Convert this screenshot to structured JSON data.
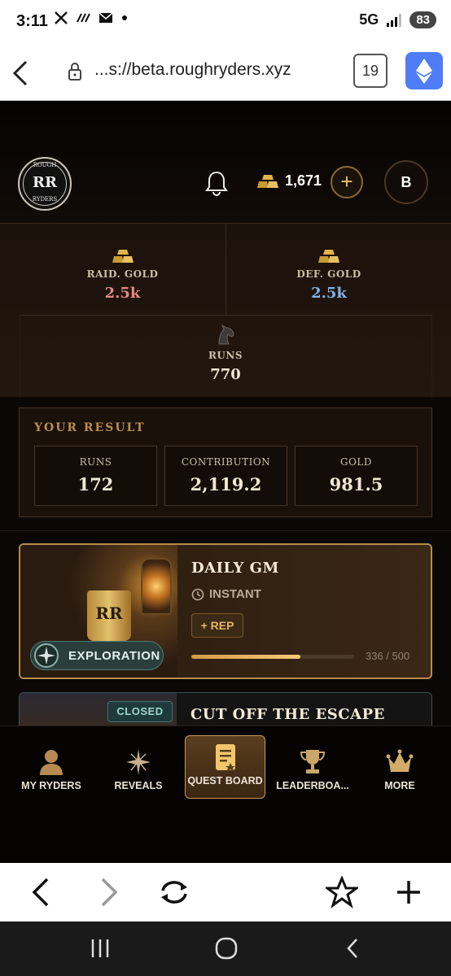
{
  "status_bar": {
    "time": "3:11",
    "network": "5G",
    "battery": "83"
  },
  "browser": {
    "url": "...s://beta.roughryders.xyz",
    "tab_count": "19"
  },
  "header": {
    "logo": {
      "top_text": "ROUGH",
      "monogram": "RR",
      "bottom_text": "RYDERS"
    },
    "gold_balance": "1,671",
    "avatar_initial": "B"
  },
  "stats": {
    "raid_gold": {
      "label": "RAID. GOLD",
      "value": "2.5k",
      "color": "#e58a86"
    },
    "def_gold": {
      "label": "DEF. GOLD",
      "value": "2.5k",
      "color": "#7fb3e8"
    },
    "runs": {
      "label": "RUNS",
      "value": "770",
      "color": "#f1e6d3"
    }
  },
  "your_result": {
    "title": "YOUR RESULT",
    "items": [
      {
        "label": "RUNS",
        "value": "172"
      },
      {
        "label": "CONTRIBUTION",
        "value": "2,119.2"
      },
      {
        "label": "GOLD",
        "value": "981.5"
      }
    ]
  },
  "quests": [
    {
      "title": "DAILY GM",
      "type_label": "INSTANT",
      "reward_label": "+ REP",
      "category": "EXPLORATION",
      "progress": {
        "current": 336,
        "total": 500,
        "text": "336 / 500"
      },
      "image_monogram": "RR"
    },
    {
      "title": "CUT OFF THE ESCAPE",
      "status": "CLOSED"
    }
  ],
  "bottom_nav": [
    {
      "label": "MY RYDERS",
      "icon": "person-icon"
    },
    {
      "label": "REVEALS",
      "icon": "sparkle-icon"
    },
    {
      "label": "QUEST BOARD",
      "icon": "quest-scroll-icon",
      "active": true
    },
    {
      "label": "LEADERBOA...",
      "icon": "trophy-icon"
    },
    {
      "label": "MORE",
      "icon": "crown-icon"
    }
  ],
  "colors": {
    "accent_gold": "#c59a57",
    "progress_fill": "#f6c978",
    "background": "#0b0705"
  }
}
